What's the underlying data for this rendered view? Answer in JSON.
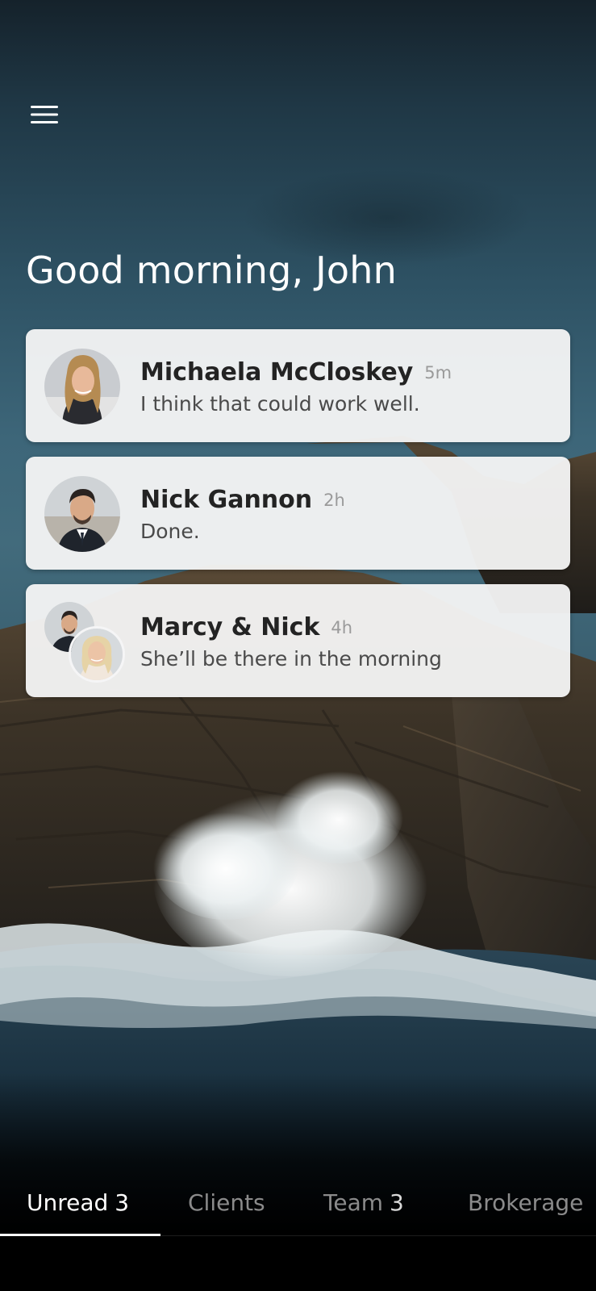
{
  "header": {
    "menu_icon": "hamburger-menu-icon",
    "greeting": "Good morning, John"
  },
  "conversations": [
    {
      "name": "Michaela McCloskey",
      "time": "5m",
      "message": "I think that could work well."
    },
    {
      "name": "Nick Gannon",
      "time": "2h",
      "message": "Done."
    },
    {
      "name": "Marcy & Nick",
      "time": "4h",
      "message": "She’ll be there in the morning"
    }
  ],
  "tabs": [
    {
      "label": "Unread",
      "count": "3",
      "active": true
    },
    {
      "label": "Clients",
      "count": "",
      "active": false
    },
    {
      "label": "Team",
      "count": "3",
      "active": false
    },
    {
      "label": "Brokerage",
      "count": "",
      "active": false
    }
  ],
  "colors": {
    "card_background": "#f5f5f6",
    "name_text": "#232323",
    "message_text": "#4a4a4a",
    "time_text": "#9a9a9a",
    "tab_active": "#ffffff",
    "tab_inactive": "#8b8b8b"
  }
}
